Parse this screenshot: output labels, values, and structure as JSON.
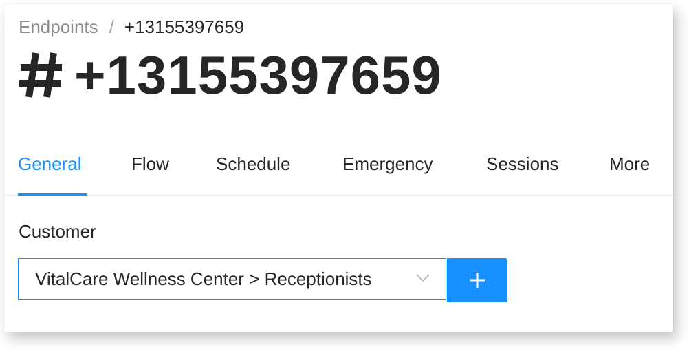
{
  "breadcrumb": {
    "parent": "Endpoints",
    "separator": "/",
    "current": "+13155397659"
  },
  "header": {
    "icon": "hash-icon",
    "title": "+13155397659"
  },
  "tabs": [
    {
      "label": "General",
      "active": true
    },
    {
      "label": "Flow",
      "active": false
    },
    {
      "label": "Schedule",
      "active": false
    },
    {
      "label": "Emergency",
      "active": false
    },
    {
      "label": "Sessions",
      "active": false
    },
    {
      "label": "More",
      "active": false
    }
  ],
  "form": {
    "customer_label": "Customer",
    "customer_value": "VitalCare Wellness Center > Receptionists",
    "add_icon": "plus-icon",
    "dropdown_icon": "chevron-down-icon"
  },
  "colors": {
    "accent": "#1890ff",
    "text": "#262626",
    "muted": "#8c8c8c"
  }
}
